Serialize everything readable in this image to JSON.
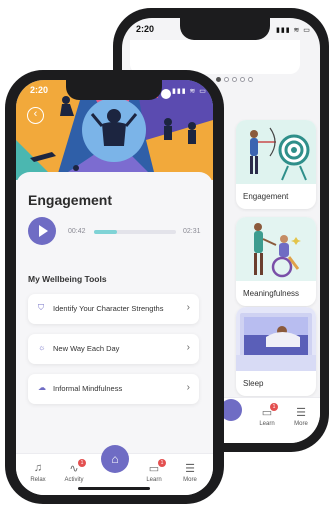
{
  "back_phone": {
    "status_time": "2:20",
    "status_icons": "▮▮▮ ≋ ▭",
    "cards": [
      {
        "label": "Engagement"
      },
      {
        "label": "Meaningfulness"
      },
      {
        "label": "Sleep"
      }
    ],
    "tabs": [
      {
        "label": "Learn",
        "icon": "book-icon",
        "glyph": "▭",
        "badge": "1"
      },
      {
        "label": "More",
        "icon": "menu-icon",
        "glyph": "☰"
      }
    ]
  },
  "front_phone": {
    "status_time": "2:20",
    "status_icons": "▮▮▮ ≋ ▭",
    "back_glyph": "‹",
    "page_title": "Engagement",
    "audio": {
      "elapsed": "00:42",
      "total": "02:31",
      "progress": 0.28
    },
    "section_title": "My Wellbeing Tools",
    "tools": [
      {
        "label": "Identify Your Character Strengths",
        "icon": "shield-icon",
        "glyph": "⛉"
      },
      {
        "label": "New Way Each Day",
        "icon": "sun-icon",
        "glyph": "☼"
      },
      {
        "label": "Informal Mindfulness",
        "icon": "mindfulness-icon",
        "glyph": "☁"
      }
    ],
    "chevron": "›",
    "tabs": [
      {
        "label": "Relax",
        "icon": "headphones-icon",
        "glyph": "♫"
      },
      {
        "label": "Activity",
        "icon": "activity-icon",
        "glyph": "∿",
        "badge": "1"
      },
      {
        "label": "Learn",
        "icon": "book-icon",
        "glyph": "▭",
        "badge": "1"
      },
      {
        "label": "More",
        "icon": "menu-icon",
        "glyph": "☰"
      }
    ],
    "home_glyph": "⌂"
  },
  "colors": {
    "accent": "#6f6cc4",
    "progress": "#7fd3d6",
    "badge": "#e35050"
  }
}
